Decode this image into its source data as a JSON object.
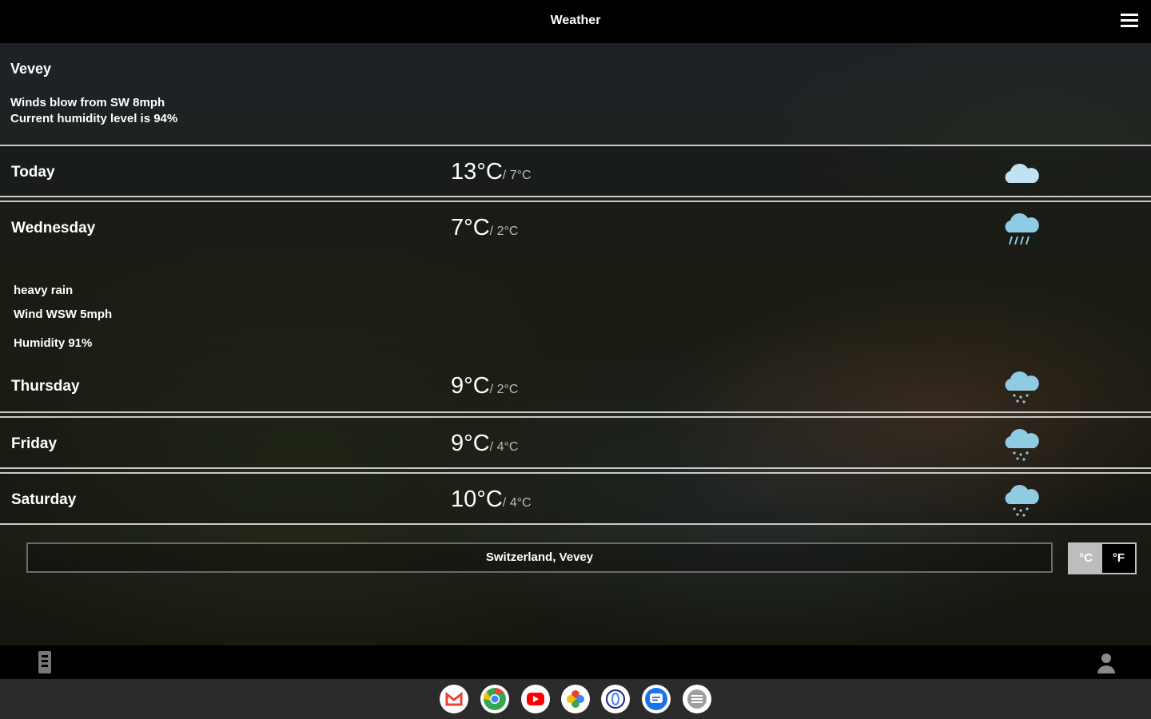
{
  "app": {
    "title": "Weather"
  },
  "current": {
    "city": "Vevey",
    "wind": "Winds blow from SW 8mph",
    "humidity": "Current humidity level is 94%"
  },
  "forecast": [
    {
      "day": "Today",
      "high": "13°C",
      "low": "/ 7°C",
      "icon": "cloud-icon"
    },
    {
      "day": "Wednesday",
      "high": "7°C",
      "low": "/ 2°C",
      "icon": "heavy-rain-icon",
      "details": {
        "condition": "heavy rain",
        "wind": "Wind WSW 5mph",
        "humidity": "Humidity 91%"
      }
    },
    {
      "day": "Thursday",
      "high": "9°C",
      "low": "/ 2°C",
      "icon": "light-rain-icon"
    },
    {
      "day": "Friday",
      "high": "9°C",
      "low": "/ 4°C",
      "icon": "light-rain-icon"
    },
    {
      "day": "Saturday",
      "high": "10°C",
      "low": "/ 4°C",
      "icon": "light-rain-icon"
    }
  ],
  "search": {
    "value": "Switzerland, Vevey"
  },
  "units": {
    "celsius": "°C",
    "fahrenheit": "°F",
    "selected": "celsius"
  },
  "colors": {
    "cloud": "#bfe3f2",
    "rain": "#8fcbe3",
    "row_border": "#c9c9c9",
    "unit_active": "#bdbdbd"
  },
  "navbar": {
    "left_icon": "phone-icon",
    "right_icon": "user-icon"
  },
  "shelf": {
    "apps": [
      "gmail-icon",
      "chrome-icon",
      "youtube-icon",
      "photos-icon",
      "assistant-icon",
      "messages-icon",
      "files-icon"
    ]
  }
}
